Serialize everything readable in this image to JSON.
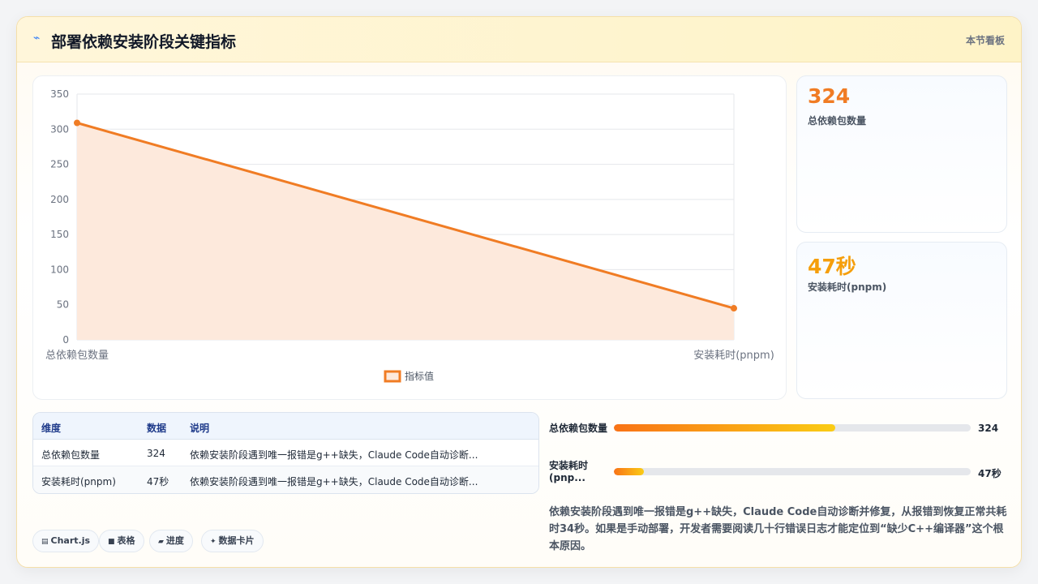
{
  "header": {
    "icon": "lightning-icon",
    "title": "部署依赖安装阶段关键指标",
    "right_label": "本节看板"
  },
  "chart_data": {
    "type": "area",
    "categories": [
      "总依赖包数量",
      "安装耗时(pnpm)"
    ],
    "series": [
      {
        "name": "指标值",
        "values": [
          309,
          45
        ]
      }
    ],
    "ylim": [
      0,
      350
    ],
    "yticks": [
      0,
      50,
      100,
      150,
      200,
      250,
      300,
      350
    ],
    "grid": true,
    "legend": "bottom-center",
    "line_color": "#f07c24",
    "fill_color": "#fde9dc"
  },
  "stats": [
    {
      "value": "324",
      "label": "总依赖包数量",
      "color": "#f07c24"
    },
    {
      "value": "47秒",
      "label": "安装耗时(pnpm)",
      "color": "#f59e0b"
    }
  ],
  "table": {
    "headers": [
      "维度",
      "数据",
      "说明"
    ],
    "rows": [
      [
        "总依赖包数量",
        "324",
        "依赖安装阶段遇到唯一报错是g++缺失，Claude Code自动诊断..."
      ],
      [
        "安装耗时(pnpm)",
        "47秒",
        "依赖安装阶段遇到唯一报错是g++缺失，Claude Code自动诊断..."
      ]
    ]
  },
  "progress": [
    {
      "label": "总依赖包数量",
      "value": "324",
      "fraction": 0.62
    },
    {
      "label": "安装耗时\n(pnp...",
      "value": "47秒",
      "fraction": 0.085
    }
  ],
  "description": "依赖安装阶段遇到唯一报错是g++缺失，Claude Code自动诊断并修复，从报错到恢复正常共耗时34秒。如果是手动部署，开发者需要阅读几十行错误日志才能定位到“缺少C++编译器”这个根本原因。",
  "tags": [
    {
      "icon": "chart-icon",
      "glyph": "▤",
      "label": "Chart.js"
    },
    {
      "icon": "table-icon",
      "glyph": "■",
      "label": "表格"
    },
    {
      "icon": "progress-icon",
      "glyph": "▰",
      "label": "进度"
    },
    {
      "icon": "card-icon",
      "glyph": "✦",
      "label": "数据卡片"
    }
  ]
}
